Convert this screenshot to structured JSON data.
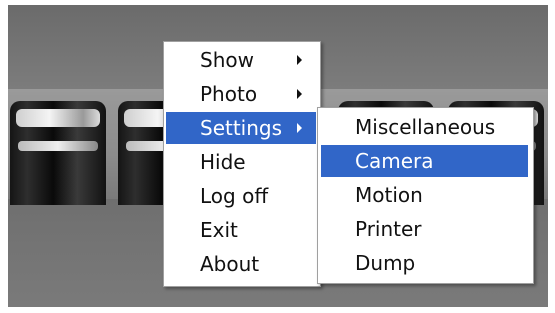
{
  "context_menu": {
    "items": [
      {
        "label": "Show",
        "has_submenu": true
      },
      {
        "label": "Photo",
        "has_submenu": true
      },
      {
        "label": "Settings",
        "has_submenu": true,
        "selected": true
      },
      {
        "label": "Hide",
        "has_submenu": false
      },
      {
        "label": "Log off",
        "has_submenu": false
      },
      {
        "label": "Exit",
        "has_submenu": false
      },
      {
        "label": "About",
        "has_submenu": false
      }
    ]
  },
  "settings_submenu": {
    "items": [
      {
        "label": "Miscellaneous"
      },
      {
        "label": "Camera",
        "selected": true
      },
      {
        "label": "Motion"
      },
      {
        "label": "Printer"
      },
      {
        "label": "Dump"
      }
    ]
  },
  "colors": {
    "highlight": "#3166c8",
    "menu_background": "#ffffff",
    "menu_text": "#111111"
  }
}
